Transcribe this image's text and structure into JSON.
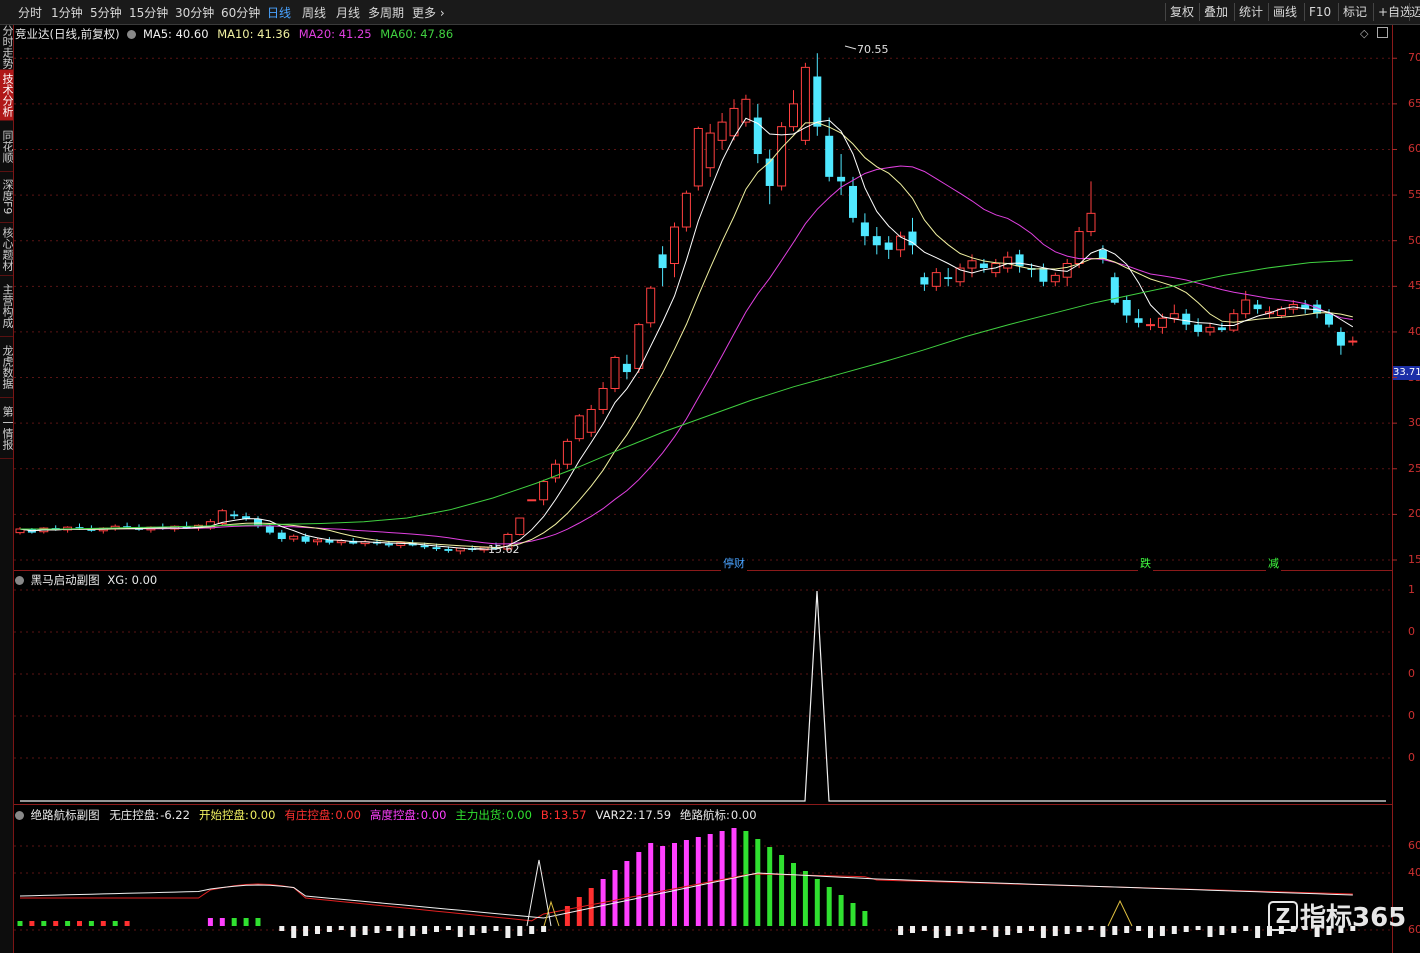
{
  "toolbar": {
    "periods": [
      "分时",
      "1分钟",
      "5分钟",
      "15分钟",
      "30分钟",
      "60分钟",
      "日线",
      "周线",
      "月线",
      "多周期",
      "更多"
    ],
    "active_period": "日线",
    "right_tools": [
      "复权",
      "叠加",
      "统计",
      "画线",
      "F10",
      "标记",
      "+自选",
      "迈"
    ]
  },
  "sidebar": {
    "tabs": [
      "分时走势",
      "技术分析",
      "同花顺",
      "深度F9",
      "核心题材",
      "主营构成",
      "龙虎数据",
      "第一情报"
    ],
    "active_tab": "技术分析"
  },
  "main_pane": {
    "stock_label": "竞业达(日线,前复权)",
    "ma_legend": [
      {
        "label": "MA5:",
        "value": "40.60",
        "color": "#f0f0f0"
      },
      {
        "label": "MA10:",
        "value": "41.36",
        "color": "#f0f0a0"
      },
      {
        "label": "MA20:",
        "value": "41.25",
        "color": "#e040e0"
      },
      {
        "label": "MA60:",
        "value": "47.86",
        "color": "#40d040"
      }
    ],
    "y_ticks": [
      "70",
      "65",
      "60",
      "55",
      "50",
      "45",
      "40",
      "35",
      "30",
      "25",
      "20",
      "15"
    ],
    "high_label": "70.55",
    "low_label": "15.62",
    "current_price": "33.71",
    "tags": [
      {
        "text": "停财",
        "color": "#4aa3ff"
      },
      {
        "text": "跌",
        "color": "#40ff40"
      },
      {
        "text": "减",
        "color": "#40ff40"
      }
    ]
  },
  "sub1": {
    "title": "黑马启动副图",
    "xg_label": "XG:",
    "xg_value": "0.00",
    "y_ticks": [
      "1",
      "0",
      "0",
      "0",
      "0"
    ]
  },
  "sub2": {
    "title": "绝路航标副图",
    "values": [
      {
        "label": "无庄控盘:",
        "value": "-6.22",
        "color": "#e8e8e8"
      },
      {
        "label": "开始控盘:",
        "value": "0.00",
        "color": "#f0f060"
      },
      {
        "label": "有庄控盘:",
        "value": "0.00",
        "color": "#ff3030"
      },
      {
        "label": "高度控盘:",
        "value": "0.00",
        "color": "#ff40ff"
      },
      {
        "label": "主力出货:",
        "value": "0.00",
        "color": "#30e030"
      },
      {
        "label": "B:",
        "value": "13.57",
        "color": "#ff3030"
      },
      {
        "label": "VAR22:",
        "value": "17.59",
        "color": "#e8e8e8"
      },
      {
        "label": "绝路航标:",
        "value": "0.00",
        "color": "#e8e8e8"
      }
    ],
    "y_ticks": [
      "60",
      "40",
      "60"
    ]
  },
  "brand": "指标365",
  "colors": {
    "up": "#ff4040",
    "down": "#50e8ff",
    "ma5": "#ffffff",
    "ma10": "#f0f0a0",
    "ma20": "#e040e0",
    "ma60": "#40d040"
  },
  "chart_data": [
    {
      "type": "candlestick",
      "title": "竞业达(日线,前复权)",
      "ylim": [
        15,
        72
      ],
      "y_ticks": [
        70,
        65,
        60,
        55,
        50,
        45,
        40,
        35,
        30,
        25,
        20,
        15
      ],
      "candles": [
        [
          18.0,
          18.6,
          17.8,
          18.4
        ],
        [
          18.4,
          18.5,
          17.9,
          18.0
        ],
        [
          18.1,
          18.6,
          17.9,
          18.5
        ],
        [
          18.5,
          18.8,
          18.2,
          18.3
        ],
        [
          18.3,
          18.7,
          18.0,
          18.6
        ],
        [
          18.6,
          19.0,
          18.3,
          18.5
        ],
        [
          18.5,
          18.8,
          18.1,
          18.2
        ],
        [
          18.2,
          18.6,
          17.9,
          18.5
        ],
        [
          18.5,
          18.9,
          18.2,
          18.7
        ],
        [
          18.7,
          19.1,
          18.4,
          18.6
        ],
        [
          18.6,
          18.9,
          18.2,
          18.3
        ],
        [
          18.3,
          18.7,
          18.0,
          18.6
        ],
        [
          18.6,
          19.0,
          18.3,
          18.4
        ],
        [
          18.4,
          18.8,
          18.1,
          18.7
        ],
        [
          18.7,
          19.2,
          18.4,
          18.5
        ],
        [
          18.5,
          18.9,
          18.2,
          18.8
        ],
        [
          18.5,
          19.5,
          18.3,
          19.2
        ],
        [
          19.0,
          20.6,
          18.8,
          20.4
        ],
        [
          20.0,
          20.4,
          19.5,
          19.8
        ],
        [
          19.8,
          20.2,
          19.3,
          19.5
        ],
        [
          19.5,
          19.8,
          18.5,
          18.7
        ],
        [
          18.7,
          19.0,
          17.8,
          18.0
        ],
        [
          18.0,
          18.3,
          17.0,
          17.3
        ],
        [
          17.3,
          17.8,
          17.0,
          17.6
        ],
        [
          17.6,
          17.9,
          16.8,
          17.0
        ],
        [
          17.0,
          17.4,
          16.6,
          17.2
        ],
        [
          17.2,
          17.5,
          16.7,
          16.9
        ],
        [
          16.9,
          17.3,
          16.6,
          17.1
        ],
        [
          17.1,
          17.4,
          16.7,
          16.8
        ],
        [
          16.8,
          17.2,
          16.5,
          17.0
        ],
        [
          17.0,
          17.3,
          16.6,
          16.8
        ],
        [
          16.8,
          17.1,
          16.4,
          16.6
        ],
        [
          16.6,
          17.0,
          16.3,
          16.9
        ],
        [
          16.9,
          17.2,
          16.5,
          16.6
        ],
        [
          16.6,
          16.9,
          16.2,
          16.4
        ],
        [
          16.4,
          16.8,
          16.0,
          16.2
        ],
        [
          16.2,
          16.5,
          15.8,
          16.0
        ],
        [
          16.0,
          16.4,
          15.62,
          16.3
        ],
        [
          16.3,
          16.6,
          15.9,
          16.1
        ],
        [
          16.1,
          16.5,
          15.8,
          16.4
        ],
        [
          16.4,
          16.9,
          16.1,
          16.2
        ],
        [
          16.2,
          18.0,
          16.0,
          17.8
        ],
        [
          17.8,
          19.6,
          17.7,
          19.6
        ],
        [
          21.6,
          21.6,
          21.6,
          21.6
        ],
        [
          21.6,
          23.8,
          21.0,
          23.6
        ],
        [
          24.0,
          26.0,
          23.5,
          25.5
        ],
        [
          25.5,
          28.3,
          25.0,
          28.0
        ],
        [
          28.3,
          31.0,
          28.0,
          30.8
        ],
        [
          29.0,
          32.0,
          28.5,
          31.5
        ],
        [
          31.5,
          34.5,
          31.0,
          33.8
        ],
        [
          33.8,
          37.4,
          33.4,
          37.2
        ],
        [
          36.5,
          37.5,
          34.8,
          35.6
        ],
        [
          36.0,
          41.0,
          35.5,
          40.8
        ],
        [
          41.0,
          45.0,
          40.5,
          44.8
        ],
        [
          48.5,
          49.4,
          45.0,
          47.0
        ],
        [
          47.5,
          52.0,
          46.0,
          51.5
        ],
        [
          51.5,
          55.5,
          51.0,
          55.2
        ],
        [
          56.0,
          62.5,
          55.5,
          62.3
        ],
        [
          58.0,
          62.8,
          57.0,
          61.8
        ],
        [
          61.0,
          64.0,
          60.0,
          63.0
        ],
        [
          61.5,
          65.5,
          61.0,
          64.5
        ],
        [
          63.0,
          66.0,
          62.5,
          65.5
        ],
        [
          63.5,
          65.0,
          58.5,
          59.5
        ],
        [
          59.0,
          60.0,
          54.0,
          56.0
        ],
        [
          56.0,
          63.0,
          55.5,
          62.5
        ],
        [
          62.5,
          66.5,
          62.0,
          65.0
        ],
        [
          61.0,
          69.5,
          60.5,
          69.0
        ],
        [
          68.0,
          70.55,
          61.5,
          62.5
        ],
        [
          61.5,
          63.5,
          56.5,
          57.0
        ],
        [
          57.0,
          59.5,
          55.0,
          56.5
        ],
        [
          56.0,
          57.0,
          52.0,
          52.5
        ],
        [
          52.0,
          53.0,
          49.5,
          50.5
        ],
        [
          50.5,
          51.5,
          48.5,
          49.5
        ],
        [
          49.8,
          50.5,
          48.0,
          49.0
        ],
        [
          49.0,
          51.0,
          48.2,
          50.5
        ],
        [
          51.0,
          52.5,
          48.5,
          49.5
        ],
        [
          46.0,
          46.5,
          44.5,
          45.2
        ],
        [
          45.0,
          47.0,
          44.5,
          46.5
        ],
        [
          46.0,
          47.0,
          45.0,
          45.8
        ],
        [
          45.5,
          47.5,
          45.0,
          47.0
        ],
        [
          47.0,
          48.5,
          46.0,
          47.8
        ],
        [
          47.5,
          48.0,
          46.5,
          47.0
        ],
        [
          46.5,
          48.0,
          46.0,
          47.5
        ],
        [
          47.0,
          48.8,
          46.5,
          48.2
        ],
        [
          48.5,
          49.0,
          46.5,
          47.2
        ],
        [
          47.0,
          47.5,
          46.0,
          46.8
        ],
        [
          47.0,
          47.5,
          45.0,
          45.5
        ],
        [
          45.5,
          46.5,
          45.0,
          46.2
        ],
        [
          46.0,
          48.0,
          45.0,
          47.5
        ],
        [
          47.5,
          51.5,
          47.0,
          51.0
        ],
        [
          51.0,
          56.5,
          50.5,
          53.0
        ],
        [
          49.0,
          49.5,
          47.5,
          48.0
        ],
        [
          46.0,
          46.5,
          43.0,
          43.2
        ],
        [
          43.5,
          44.0,
          41.0,
          41.8
        ],
        [
          41.5,
          42.5,
          40.5,
          41.0
        ],
        [
          40.8,
          41.5,
          40.2,
          40.8
        ],
        [
          40.5,
          42.0,
          39.8,
          41.5
        ],
        [
          41.5,
          43.0,
          41.0,
          42.0
        ],
        [
          42.0,
          42.5,
          40.2,
          40.8
        ],
        [
          40.8,
          41.5,
          39.5,
          40.0
        ],
        [
          40.0,
          41.0,
          39.6,
          40.5
        ],
        [
          40.5,
          41.0,
          40.0,
          40.2
        ],
        [
          40.2,
          42.5,
          40.0,
          42.0
        ],
        [
          42.0,
          44.5,
          41.5,
          43.5
        ],
        [
          43.0,
          43.5,
          42.0,
          42.5
        ],
        [
          42.0,
          42.8,
          41.5,
          42.2
        ],
        [
          41.8,
          42.8,
          41.5,
          42.5
        ],
        [
          42.5,
          43.5,
          42.0,
          43.0
        ],
        [
          43.0,
          43.5,
          42.0,
          42.5
        ],
        [
          43.0,
          43.5,
          41.5,
          42.0
        ],
        [
          42.0,
          42.5,
          40.5,
          40.8
        ],
        [
          40.0,
          40.5,
          37.5,
          38.5
        ],
        [
          39.0,
          39.5,
          38.5,
          39.0
        ]
      ],
      "ma60": [
        18.4,
        18.4,
        18.5,
        18.6,
        18.7,
        18.8,
        18.9,
        19.0,
        19.2,
        19.6,
        20.5,
        21.8,
        23.4,
        25.2,
        27.2,
        29.1,
        30.8,
        32.5,
        34.0,
        35.3,
        36.6,
        38.0,
        39.5,
        40.8,
        42.0,
        43.2,
        44.2,
        45.2,
        46.2,
        47.0,
        47.6,
        47.86
      ]
    },
    {
      "type": "line",
      "title": "黑马启动副图",
      "series": [
        {
          "name": "XG",
          "values": [
            0,
            0,
            0,
            1,
            0,
            0
          ]
        }
      ]
    }
  ]
}
